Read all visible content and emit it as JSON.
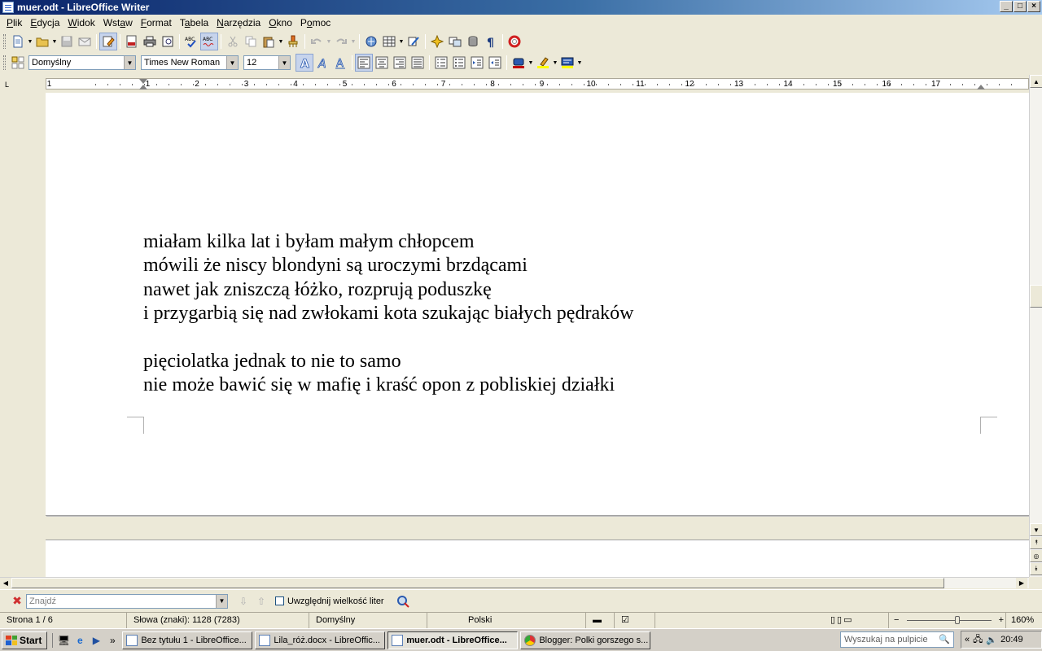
{
  "window": {
    "title": "muer.odt - LibreOffice Writer",
    "controls": {
      "minimize": "_",
      "maximize": "□",
      "close": "×"
    }
  },
  "menu": [
    "Plik",
    "Edycja",
    "Widok",
    "Wstaw",
    "Format",
    "Tabela",
    "Narzędzia",
    "Okno",
    "Pomoc"
  ],
  "menu_underline": [
    "P",
    "E",
    "W",
    "a",
    "F",
    "a",
    "N",
    "O",
    "o"
  ],
  "formatting": {
    "paragraph_style": "Domyślny",
    "font_name": "Times New Roman",
    "font_size": "12"
  },
  "ruler": {
    "corner": "L",
    "numbers": [
      "1",
      "",
      "1",
      "2",
      "3",
      "4",
      "5",
      "6",
      "7",
      "8",
      "9",
      "10",
      "11",
      "12",
      "13",
      "14",
      "15",
      "16",
      "17"
    ]
  },
  "document": {
    "lines": [
      "miałam kilka lat i byłam małym chłopcem",
      "mówili że niscy blondyni są uroczymi brzdącami",
      "nawet jak zniszczą łóżko, rozprują poduszkę",
      "i przygarbią się nad zwłokami kota szukając białych pędraków",
      "",
      "pięciolatka jednak to nie to samo",
      "nie może bawić się w mafię i kraść opon z pobliskiej działki"
    ]
  },
  "findbar": {
    "placeholder": "Znajdź",
    "match_case_label": "Uwzględnij wielkość liter"
  },
  "status": {
    "page": "Strona 1 / 6",
    "words": "Słowa (znaki): 1128 (7283)",
    "page_style": "Domyślny",
    "language": "Polski",
    "zoom": "160%",
    "zoom_level": 0.6
  },
  "taskbar": {
    "start_label": "Start",
    "tasks": [
      "Bez tytułu 1 - LibreOffice...",
      "Lila_róż.docx - LibreOffic...",
      "muer.odt - LibreOffice...",
      "Blogger: Polki gorszego s..."
    ],
    "search_placeholder": "Wyszukaj na pulpicie",
    "clock": "20:49"
  }
}
